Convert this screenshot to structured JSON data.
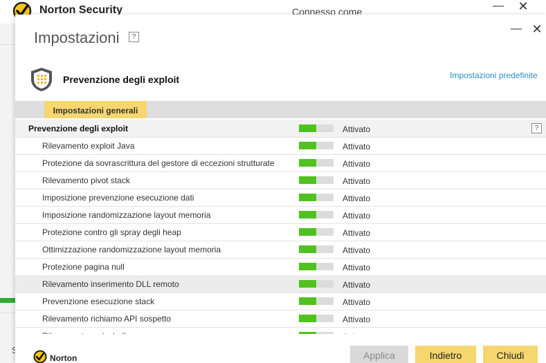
{
  "main_window": {
    "title": "Norton Security",
    "connected_text": "Connesso come",
    "minimize_glyph": "—",
    "close_glyph": "✕",
    "left_letter": "S"
  },
  "dialog": {
    "title": "Impostazioni",
    "help_glyph": "?",
    "minimize_glyph": "—",
    "close_glyph": "✕",
    "section_title": "Prevenzione degli exploit",
    "defaults_link": "Impostazioni predefinite",
    "tab_label": "Impostazioni generali",
    "brand": "Norton"
  },
  "rows": [
    {
      "label": "Prevenzione degli exploit",
      "status": "Attivato",
      "toggle_on": 0.5,
      "header": true
    },
    {
      "label": "Rilevamento exploit Java",
      "status": "Attivato",
      "toggle_on": 0.5
    },
    {
      "label": "Protezione da sovrascrittura del gestore di eccezioni strutturate",
      "status": "Attivato",
      "toggle_on": 0.5
    },
    {
      "label": "Rilevamento pivot stack",
      "status": "Attivato",
      "toggle_on": 0.5
    },
    {
      "label": "Imposizione prevenzione esecuzione dati",
      "status": "Attivato",
      "toggle_on": 0.5
    },
    {
      "label": "Imposizione randomizzazione layout memoria",
      "status": "Attivato",
      "toggle_on": 0.5
    },
    {
      "label": "Protezione contro gli spray degli heap",
      "status": "Attivato",
      "toggle_on": 0.5
    },
    {
      "label": "Ottimizzazione randomizzazione layout memoria",
      "status": "Attivato",
      "toggle_on": 0.5
    },
    {
      "label": "Protezione pagina null",
      "status": "Attivato",
      "toggle_on": 0.5
    },
    {
      "label": "Rilevamento inserimento DLL remoto",
      "status": "Attivato",
      "toggle_on": 0.5,
      "highlight": true
    },
    {
      "label": "Prevenzione esecuzione stack",
      "status": "Attivato",
      "toggle_on": 0.5
    },
    {
      "label": "Rilevamento richiamo API sospetto",
      "status": "Attivato",
      "toggle_on": 0.5
    },
    {
      "label": "Rilevamento codeshell",
      "status": "Attivato",
      "toggle_on": 0.5
    }
  ],
  "buttons": {
    "apply": "Applica",
    "back": "Indietro",
    "close": "Chiudi"
  },
  "colors": {
    "accent_yellow": "#f5d66f",
    "toggle_green": "#4fc21f",
    "link_blue": "#2c8fc7"
  }
}
